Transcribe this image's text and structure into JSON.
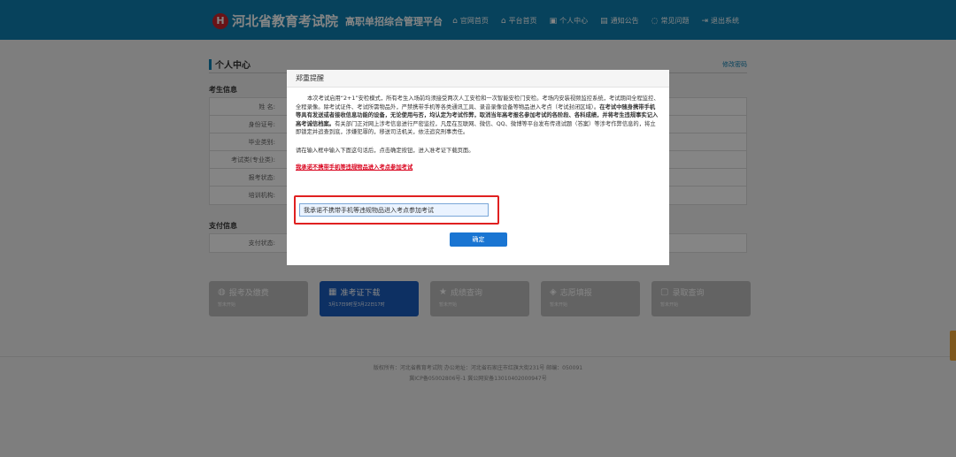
{
  "header": {
    "logo_mark": "H",
    "title": "河北省教育考试院",
    "subtitle": "高职单招综合管理平台",
    "nav": [
      {
        "icon": "home-icon",
        "glyph": "⌂",
        "label": "官网首页"
      },
      {
        "icon": "platform-home-icon",
        "glyph": "⌂",
        "label": "平台首页"
      },
      {
        "icon": "user-center-icon",
        "glyph": "▣",
        "label": "个人中心"
      },
      {
        "icon": "notice-icon",
        "glyph": "▤",
        "label": "通知公告"
      },
      {
        "icon": "faq-icon",
        "glyph": "◌",
        "label": "常见问题"
      },
      {
        "icon": "logout-icon",
        "glyph": "⇥",
        "label": "退出系统"
      }
    ]
  },
  "page": {
    "title": "个人中心",
    "edit_link": "修改密码",
    "exam_info_heading": "考生信息",
    "exam_info_rows": [
      "姓    名:",
      "身份证号:",
      "毕业类别:",
      "考试类(专业类):",
      "报考状态:",
      "培训机构:"
    ],
    "pay_info_heading": "支付信息",
    "pay_info_rows": [
      "支付状态:"
    ]
  },
  "cards": [
    {
      "icon": "payment-icon",
      "glyph": "◍",
      "title": "报考及缴费",
      "sub": "暂未开始",
      "active": false
    },
    {
      "icon": "admission-ticket-icon",
      "glyph": "▦",
      "title": "准考证下载",
      "sub": "3月17日9时至3月22日17时",
      "active": true
    },
    {
      "icon": "score-icon",
      "glyph": "★",
      "title": "成绩查询",
      "sub": "暂未开始",
      "active": false
    },
    {
      "icon": "volunteer-icon",
      "glyph": "◈",
      "title": "志愿填报",
      "sub": "暂未开始",
      "active": false
    },
    {
      "icon": "admission-query-icon",
      "glyph": "▢",
      "title": "录取查询",
      "sub": "暂未开始",
      "active": false
    }
  ],
  "footer": {
    "line1": "版权所有：河北省教育考试院    办公地址：河北省石家庄市红旗大街231号    邮编：050091",
    "line2": "冀ICP备05002806号-1    冀公网安备13010402000947号"
  },
  "modal": {
    "title": "郑重提醒",
    "para_normal": "本次考试启用“2+1”安检模式，所有考生入场前均须接受两次人工安检和一次智能安检门安检。考场内安装视频监控系统，考试期间全程监控、全程录像。除考试证件、考试所需物品外，严禁携带手机等各类通讯工具、录音录像设备等物品进入考点（考试封闭区域）。",
    "para_bold": "在考试中随身携带手机等具有发送或者接收信息功能的设备，无论使用与否，均认定为考试作弊，取消当年高考报名参加考试的各阶段、各科成绩，并将考生违规事实记入高考诚信档案。",
    "para_tail": "有关部门正对网上涉考信息进行严密监控，凡是在互联网、微信、QQ、微博等平台发布传递试题（答案）等涉考作弊信息的，将立即锁定并追查到底，涉嫌犯罪的，移送司法机关，依法追究刑事责任。",
    "instruction": "请在输入框中输入下面这句话后，点击确定按钮，进入准考证下载页面。",
    "pledge_text": "我承诺不携带手机等违规物品进入考点参加考试",
    "input_value": "我承诺不携带手机等违规物品进入考点参加考试",
    "confirm_label": "确定"
  },
  "colors": {
    "header_bg": "#0f7fb0",
    "confirm_btn": "#1a75d2",
    "pledge_red": "#d9001b",
    "highlight_border": "#e02020",
    "active_card": "#1a5dbf"
  }
}
